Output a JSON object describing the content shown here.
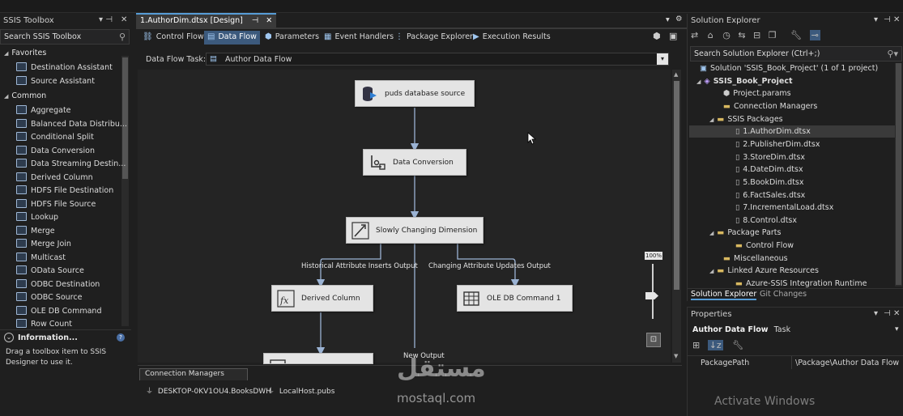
{
  "toolbox": {
    "title": "SSIS Toolbox",
    "search_placeholder": "Search SSIS Toolbox",
    "favorites_label": "Favorites",
    "favorites": [
      "Destination Assistant",
      "Source Assistant"
    ],
    "common_label": "Common",
    "common": [
      "Aggregate",
      "Balanced Data Distribu...",
      "Conditional Split",
      "Data Conversion",
      "Data Streaming Destin...",
      "Derived Column",
      "HDFS File Destination",
      "HDFS File Source",
      "Lookup",
      "Merge",
      "Merge Join",
      "Multicast",
      "OData Source",
      "ODBC Destination",
      "ODBC Source",
      "OLE DB Command",
      "Row Count"
    ]
  },
  "info": {
    "title": "Information...",
    "text": "Drag a toolbox item to SSIS Designer to use it."
  },
  "document": {
    "tab_title": "1.AuthorDim.dtsx [Design]",
    "tabs": [
      "Control Flow",
      "Data Flow",
      "Parameters",
      "Event Handlers",
      "Package Explorer",
      "Execution Results"
    ],
    "active_tab": "Data Flow",
    "task_label": "Data Flow Task:",
    "task_value": "Author Data Flow",
    "zoom": "100%"
  },
  "dataflow": {
    "nodes": {
      "source": "puds database source",
      "conversion": "Data Conversion",
      "scd": "Slowly Changing Dimension",
      "derived": "Derived Column",
      "oledb": "OLE DB Command 1"
    },
    "edges": {
      "historical": "Historical Attribute Inserts Output",
      "changing": "Changing Attribute Updates Output",
      "new": "New Output"
    }
  },
  "connections": {
    "tab": "Connection Managers",
    "items": [
      "DESKTOP-0KV1OU4.BooksDWH",
      "LocalHost.pubs"
    ]
  },
  "solution_explorer": {
    "title": "Solution Explorer",
    "search_placeholder": "Search Solution Explorer (Ctrl+;)",
    "solution": "Solution 'SSIS_Book_Project' (1 of 1 project)",
    "project": "SSIS_Book_Project",
    "project_params": "Project.params",
    "connection_managers": "Connection Managers",
    "ssis_packages": "SSIS Packages",
    "packages": [
      "1.AuthorDim.dtsx",
      "2.PublisherDim.dtsx",
      "3.StoreDim.dtsx",
      "4.DateDim.dtsx",
      "5.BookDim.dtsx",
      "6.FactSales.dtsx",
      "7.IncrementalLoad.dtsx",
      "8.Control.dtsx"
    ],
    "package_parts": "Package Parts",
    "control_flow": "Control Flow",
    "miscellaneous": "Miscellaneous",
    "linked_azure": "Linked Azure Resources",
    "azure_runtime": "Azure-SSIS Integration Runtime",
    "bottom_tabs": [
      "Solution Explorer",
      "Git Changes"
    ]
  },
  "properties": {
    "title": "Properties",
    "object_name": "Author Data Flow",
    "object_type": "Task",
    "rows": [
      {
        "name": "PackagePath",
        "value": "\\Package\\Author Data Flow"
      }
    ]
  },
  "watermark": {
    "brand_arabic": "مستقل",
    "brand_latin": "mostaql.com",
    "activate": "Activate Windows"
  },
  "colors": {
    "accent": "#569cd6",
    "background": "#1f1f1f",
    "canvas": "#242424",
    "node": "#e4e4e4"
  }
}
